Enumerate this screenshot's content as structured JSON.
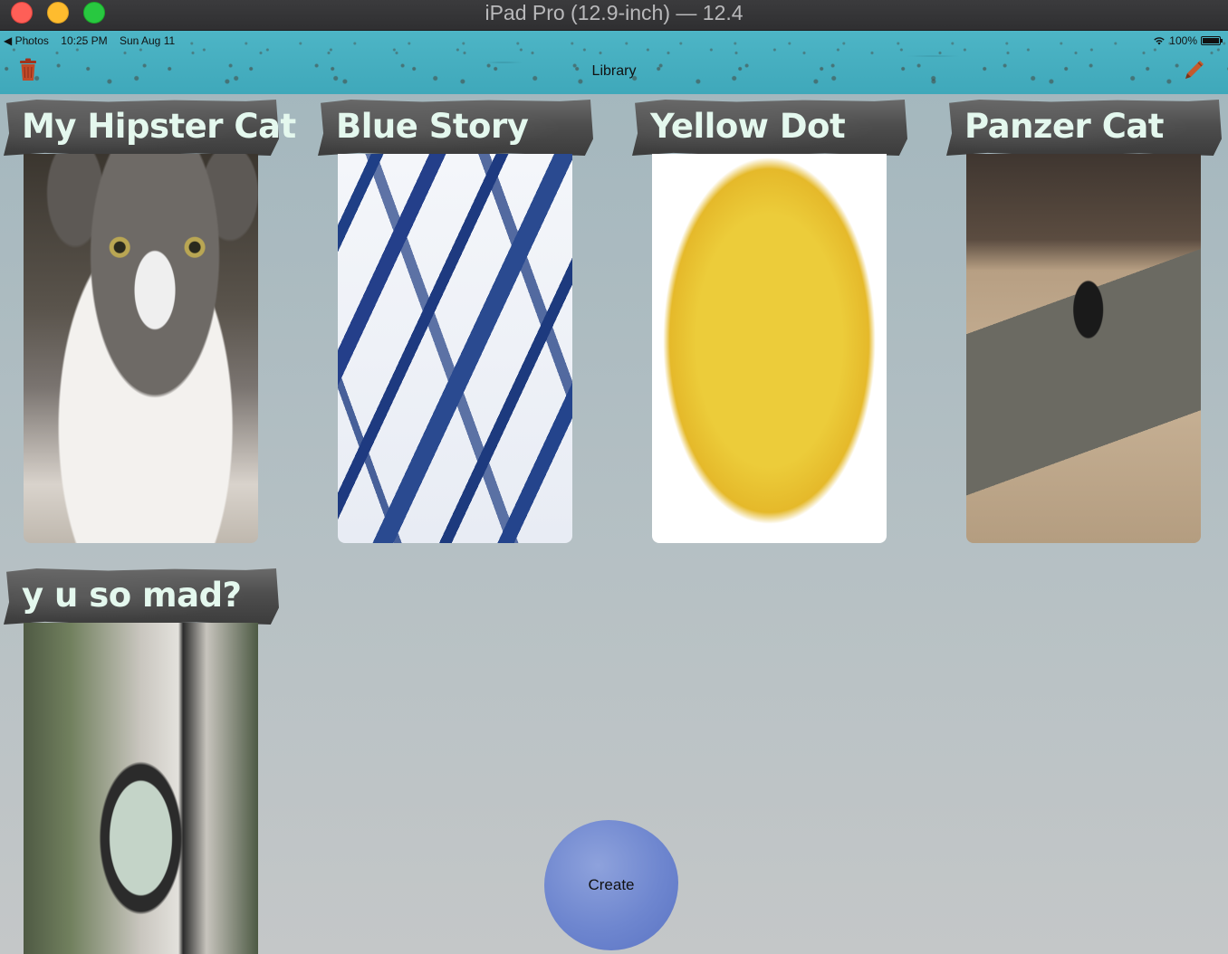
{
  "window": {
    "title": "iPad Pro (12.9-inch) — 12.4"
  },
  "status_bar": {
    "back_app": "◀ Photos",
    "time": "10:25 PM",
    "date": "Sun Aug 11",
    "battery": "100%",
    "battery_level": 1.0
  },
  "nav": {
    "title": "Library",
    "left_icon": "trash-icon",
    "right_icon": "pencil-icon"
  },
  "stories": [
    {
      "title": "My Hipster Cat"
    },
    {
      "title": "Blue Story"
    },
    {
      "title": "Yellow Dot"
    },
    {
      "title": "Panzer Cat"
    },
    {
      "title": "y u so mad?"
    }
  ],
  "create_button": {
    "label": "Create"
  },
  "colors": {
    "navbar": "#4ab3c4",
    "label_text": "#e4f8ee",
    "create_button": "#6e86cf"
  }
}
